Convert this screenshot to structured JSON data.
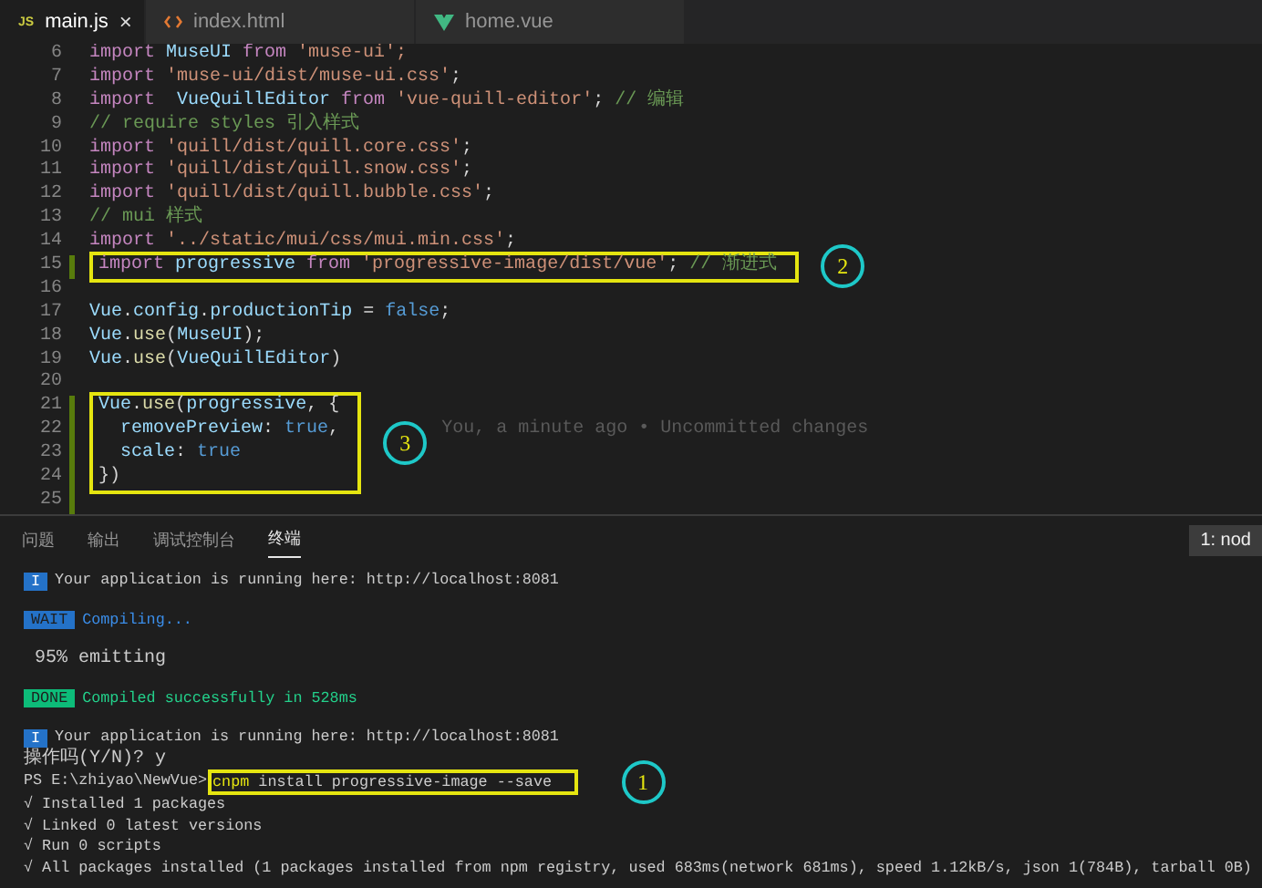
{
  "editor_tabs": [
    {
      "label": "main.js",
      "kind": "js",
      "icon_text": "JS",
      "selected": true,
      "close": "×"
    },
    {
      "label": "index.html",
      "kind": "html",
      "selected": false
    },
    {
      "label": "home.vue",
      "kind": "vue",
      "selected": false
    }
  ],
  "code_lines": [
    {
      "number": "6",
      "modified": false,
      "boxed": false,
      "tokens": [
        {
          "kind": "keyword",
          "text": "import "
        },
        {
          "kind": "ident",
          "text": "MuseUI "
        },
        {
          "kind": "keyword",
          "text": "from "
        },
        {
          "kind": "string",
          "text": "'muse-ui';"
        }
      ]
    },
    {
      "number": "7",
      "modified": false,
      "boxed": false,
      "tokens": [
        {
          "kind": "keyword",
          "text": "import "
        },
        {
          "kind": "string",
          "text": "'muse-ui/dist/muse-ui.css'"
        },
        {
          "kind": "plain",
          "text": ";"
        }
      ]
    },
    {
      "number": "8",
      "modified": false,
      "boxed": false,
      "tokens": [
        {
          "kind": "keyword",
          "text": "import  "
        },
        {
          "kind": "ident",
          "text": "VueQuillEditor "
        },
        {
          "kind": "keyword",
          "text": "from "
        },
        {
          "kind": "string",
          "text": "'vue-quill-editor'"
        },
        {
          "kind": "plain",
          "text": "; "
        },
        {
          "kind": "comment",
          "text": "// 编辑"
        }
      ]
    },
    {
      "number": "9",
      "modified": false,
      "boxed": false,
      "tokens": [
        {
          "kind": "comment",
          "text": "// require styles 引入样式"
        }
      ]
    },
    {
      "number": "10",
      "modified": false,
      "boxed": false,
      "tokens": [
        {
          "kind": "keyword",
          "text": "import "
        },
        {
          "kind": "string",
          "text": "'quill/dist/quill.core.css'"
        },
        {
          "kind": "plain",
          "text": ";"
        }
      ]
    },
    {
      "number": "11",
      "modified": false,
      "boxed": false,
      "tokens": [
        {
          "kind": "keyword",
          "text": "import "
        },
        {
          "kind": "string",
          "text": "'quill/dist/quill.snow.css'"
        },
        {
          "kind": "plain",
          "text": ";"
        }
      ]
    },
    {
      "number": "12",
      "modified": false,
      "boxed": false,
      "tokens": [
        {
          "kind": "keyword",
          "text": "import "
        },
        {
          "kind": "string",
          "text": "'quill/dist/quill.bubble.css'"
        },
        {
          "kind": "plain",
          "text": ";"
        }
      ]
    },
    {
      "number": "13",
      "modified": false,
      "boxed": false,
      "tokens": [
        {
          "kind": "comment",
          "text": "// mui 样式"
        }
      ]
    },
    {
      "number": "14",
      "modified": false,
      "boxed": false,
      "tokens": [
        {
          "kind": "keyword",
          "text": "import "
        },
        {
          "kind": "string",
          "text": "'../static/mui/css/mui.min.css'"
        },
        {
          "kind": "plain",
          "text": ";"
        }
      ]
    },
    {
      "number": "15",
      "modified": true,
      "boxed": true,
      "callout": "2",
      "tokens": [
        {
          "kind": "keyword",
          "text": "import "
        },
        {
          "kind": "ident",
          "text": "progressive "
        },
        {
          "kind": "keyword",
          "text": "from "
        },
        {
          "kind": "string",
          "text": "'progressive-image/dist/vue'"
        },
        {
          "kind": "plain",
          "text": "; "
        },
        {
          "kind": "comment",
          "text": "// 渐进式"
        }
      ]
    },
    {
      "number": "16",
      "modified": false,
      "boxed": false
    },
    {
      "number": "17",
      "modified": false,
      "boxed": false,
      "tokens": [
        {
          "kind": "ident",
          "text": "Vue"
        },
        {
          "kind": "plain",
          "text": "."
        },
        {
          "kind": "ident",
          "text": "config"
        },
        {
          "kind": "plain",
          "text": "."
        },
        {
          "kind": "ident",
          "text": "productionTip"
        },
        {
          "kind": "plain",
          "text": " = "
        },
        {
          "kind": "bool",
          "text": "false"
        },
        {
          "kind": "plain",
          "text": ";"
        }
      ]
    },
    {
      "number": "18",
      "modified": false,
      "boxed": false,
      "tokens": [
        {
          "kind": "ident",
          "text": "Vue"
        },
        {
          "kind": "plain",
          "text": "."
        },
        {
          "kind": "func",
          "text": "use"
        },
        {
          "kind": "plain",
          "text": "("
        },
        {
          "kind": "ident",
          "text": "MuseUI"
        },
        {
          "kind": "plain",
          "text": ");"
        }
      ]
    },
    {
      "number": "19",
      "modified": false,
      "boxed": false,
      "tokens": [
        {
          "kind": "ident",
          "text": "Vue"
        },
        {
          "kind": "plain",
          "text": "."
        },
        {
          "kind": "func",
          "text": "use"
        },
        {
          "kind": "plain",
          "text": "("
        },
        {
          "kind": "ident",
          "text": "VueQuillEditor"
        },
        {
          "kind": "plain",
          "text": ")"
        }
      ]
    },
    {
      "number": "20",
      "modified": false,
      "boxed": false
    },
    {
      "number": "21",
      "modified": true,
      "boxed": true,
      "callout": "3",
      "tokens": [
        {
          "kind": "ident",
          "text": "Vue"
        },
        {
          "kind": "plain",
          "text": "."
        },
        {
          "kind": "func",
          "text": "use"
        },
        {
          "kind": "plain",
          "text": "("
        },
        {
          "kind": "ident",
          "text": "progressive"
        },
        {
          "kind": "plain",
          "text": ", {"
        }
      ]
    },
    {
      "number": "22",
      "modified": true,
      "boxed": true,
      "blame": "You, a minute ago • Uncommitted changes",
      "indented": true,
      "tokens": [
        {
          "kind": "ident",
          "text": "removePreview"
        },
        {
          "kind": "plain",
          "text": ": "
        },
        {
          "kind": "bool",
          "text": "true"
        },
        {
          "kind": "plain",
          "text": ","
        }
      ]
    },
    {
      "number": "23",
      "modified": true,
      "boxed": true,
      "indented": true,
      "tokens": [
        {
          "kind": "ident",
          "text": "scale"
        },
        {
          "kind": "plain",
          "text": ": "
        },
        {
          "kind": "bool",
          "text": "true"
        }
      ]
    },
    {
      "number": "24",
      "modified": true,
      "boxed": true,
      "tokens": [
        {
          "kind": "plain",
          "text": "})"
        }
      ]
    },
    {
      "number": "25",
      "modified": true,
      "boxed": false
    }
  ],
  "panel_tabs": [
    {
      "label": "问题",
      "selected": false
    },
    {
      "label": "输出",
      "selected": false
    },
    {
      "label": "调试控制台",
      "selected": false
    },
    {
      "label": "终端",
      "selected": true
    }
  ],
  "terminal_selector": "1: nod",
  "terminal_lines": [
    {
      "kind": "info",
      "badge": "I",
      "text": "Your application is running here: http://localhost:8081",
      "blank_before": false
    },
    {
      "kind": "wait",
      "badge": "WAIT",
      "text": "Compiling...",
      "blank_before": true
    },
    {
      "kind": "plain",
      "text": " 95% emitting",
      "blank_before": true
    },
    {
      "kind": "done",
      "badge": "DONE",
      "text": "Compiled successfully in 528ms",
      "blank_before": true
    },
    {
      "kind": "info",
      "badge": "I",
      "text": "Your application is running here: http://localhost:8081",
      "blank_before": true
    },
    {
      "kind": "plain",
      "text": "操作吗(Y/N)? y",
      "blank_before": false
    },
    {
      "kind": "command",
      "prompt": "PS E:\\zhiyao\\NewVue>",
      "program": "cnpm",
      "args": " install progressive-image --save",
      "callout": "1",
      "blank_before": false
    },
    {
      "kind": "ok",
      "text": "√ Installed 1 packages",
      "blank_before": false
    },
    {
      "kind": "ok",
      "text": "√ Linked 0 latest versions",
      "blank_before": false
    },
    {
      "kind": "ok",
      "text": "√ Run 0 scripts",
      "blank_before": false
    },
    {
      "kind": "ok",
      "text": "√ All packages installed (1 packages installed from npm registry, used 683ms(network 681ms), speed 1.12kB/s, json 1(784B), tarball 0B)",
      "blank_before": false
    }
  ]
}
